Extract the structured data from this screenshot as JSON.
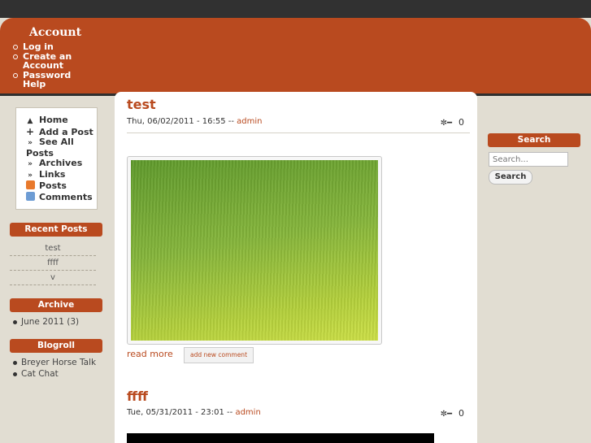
{
  "header": {
    "account_title": "Account",
    "account_links": [
      "Log in",
      "Create an Account",
      "Password Help"
    ]
  },
  "nav": {
    "items": [
      {
        "icon": "home-icon",
        "label": "Home"
      },
      {
        "icon": "plus-icon",
        "label": "Add a Post"
      },
      {
        "icon": "double-chevron-icon",
        "label": "See All Posts"
      },
      {
        "icon": "double-chevron-icon",
        "label": "Archives"
      },
      {
        "icon": "double-chevron-icon",
        "label": "Links"
      },
      {
        "icon": "rss-icon",
        "label": "Posts"
      },
      {
        "icon": "rss-icon",
        "label": "Comments"
      }
    ]
  },
  "recent_posts": {
    "title": "Recent Posts",
    "items": [
      "test",
      "ffff",
      "v"
    ]
  },
  "archive": {
    "title": "Archive",
    "items": [
      {
        "label": "June 2011",
        "count": "(3)"
      }
    ]
  },
  "blogroll": {
    "title": "Blogroll",
    "items": [
      "Breyer Horse Talk",
      "Cat Chat"
    ]
  },
  "posts": [
    {
      "title": "test",
      "date": "Thu, 06/02/2011 - 16:55",
      "sep": "--",
      "author": "admin",
      "comments": "0",
      "read_more": "read more",
      "add_comment": "add new comment"
    },
    {
      "title": "ffff",
      "date": "Tue, 05/31/2011 - 23:01",
      "sep": "--",
      "author": "admin",
      "comments": "0"
    }
  ],
  "search": {
    "title": "Search",
    "placeholder": "Search...",
    "button": "Search"
  },
  "colors": {
    "accent": "#b94a1f",
    "topbar": "#313131",
    "background": "#e1ddd2"
  }
}
